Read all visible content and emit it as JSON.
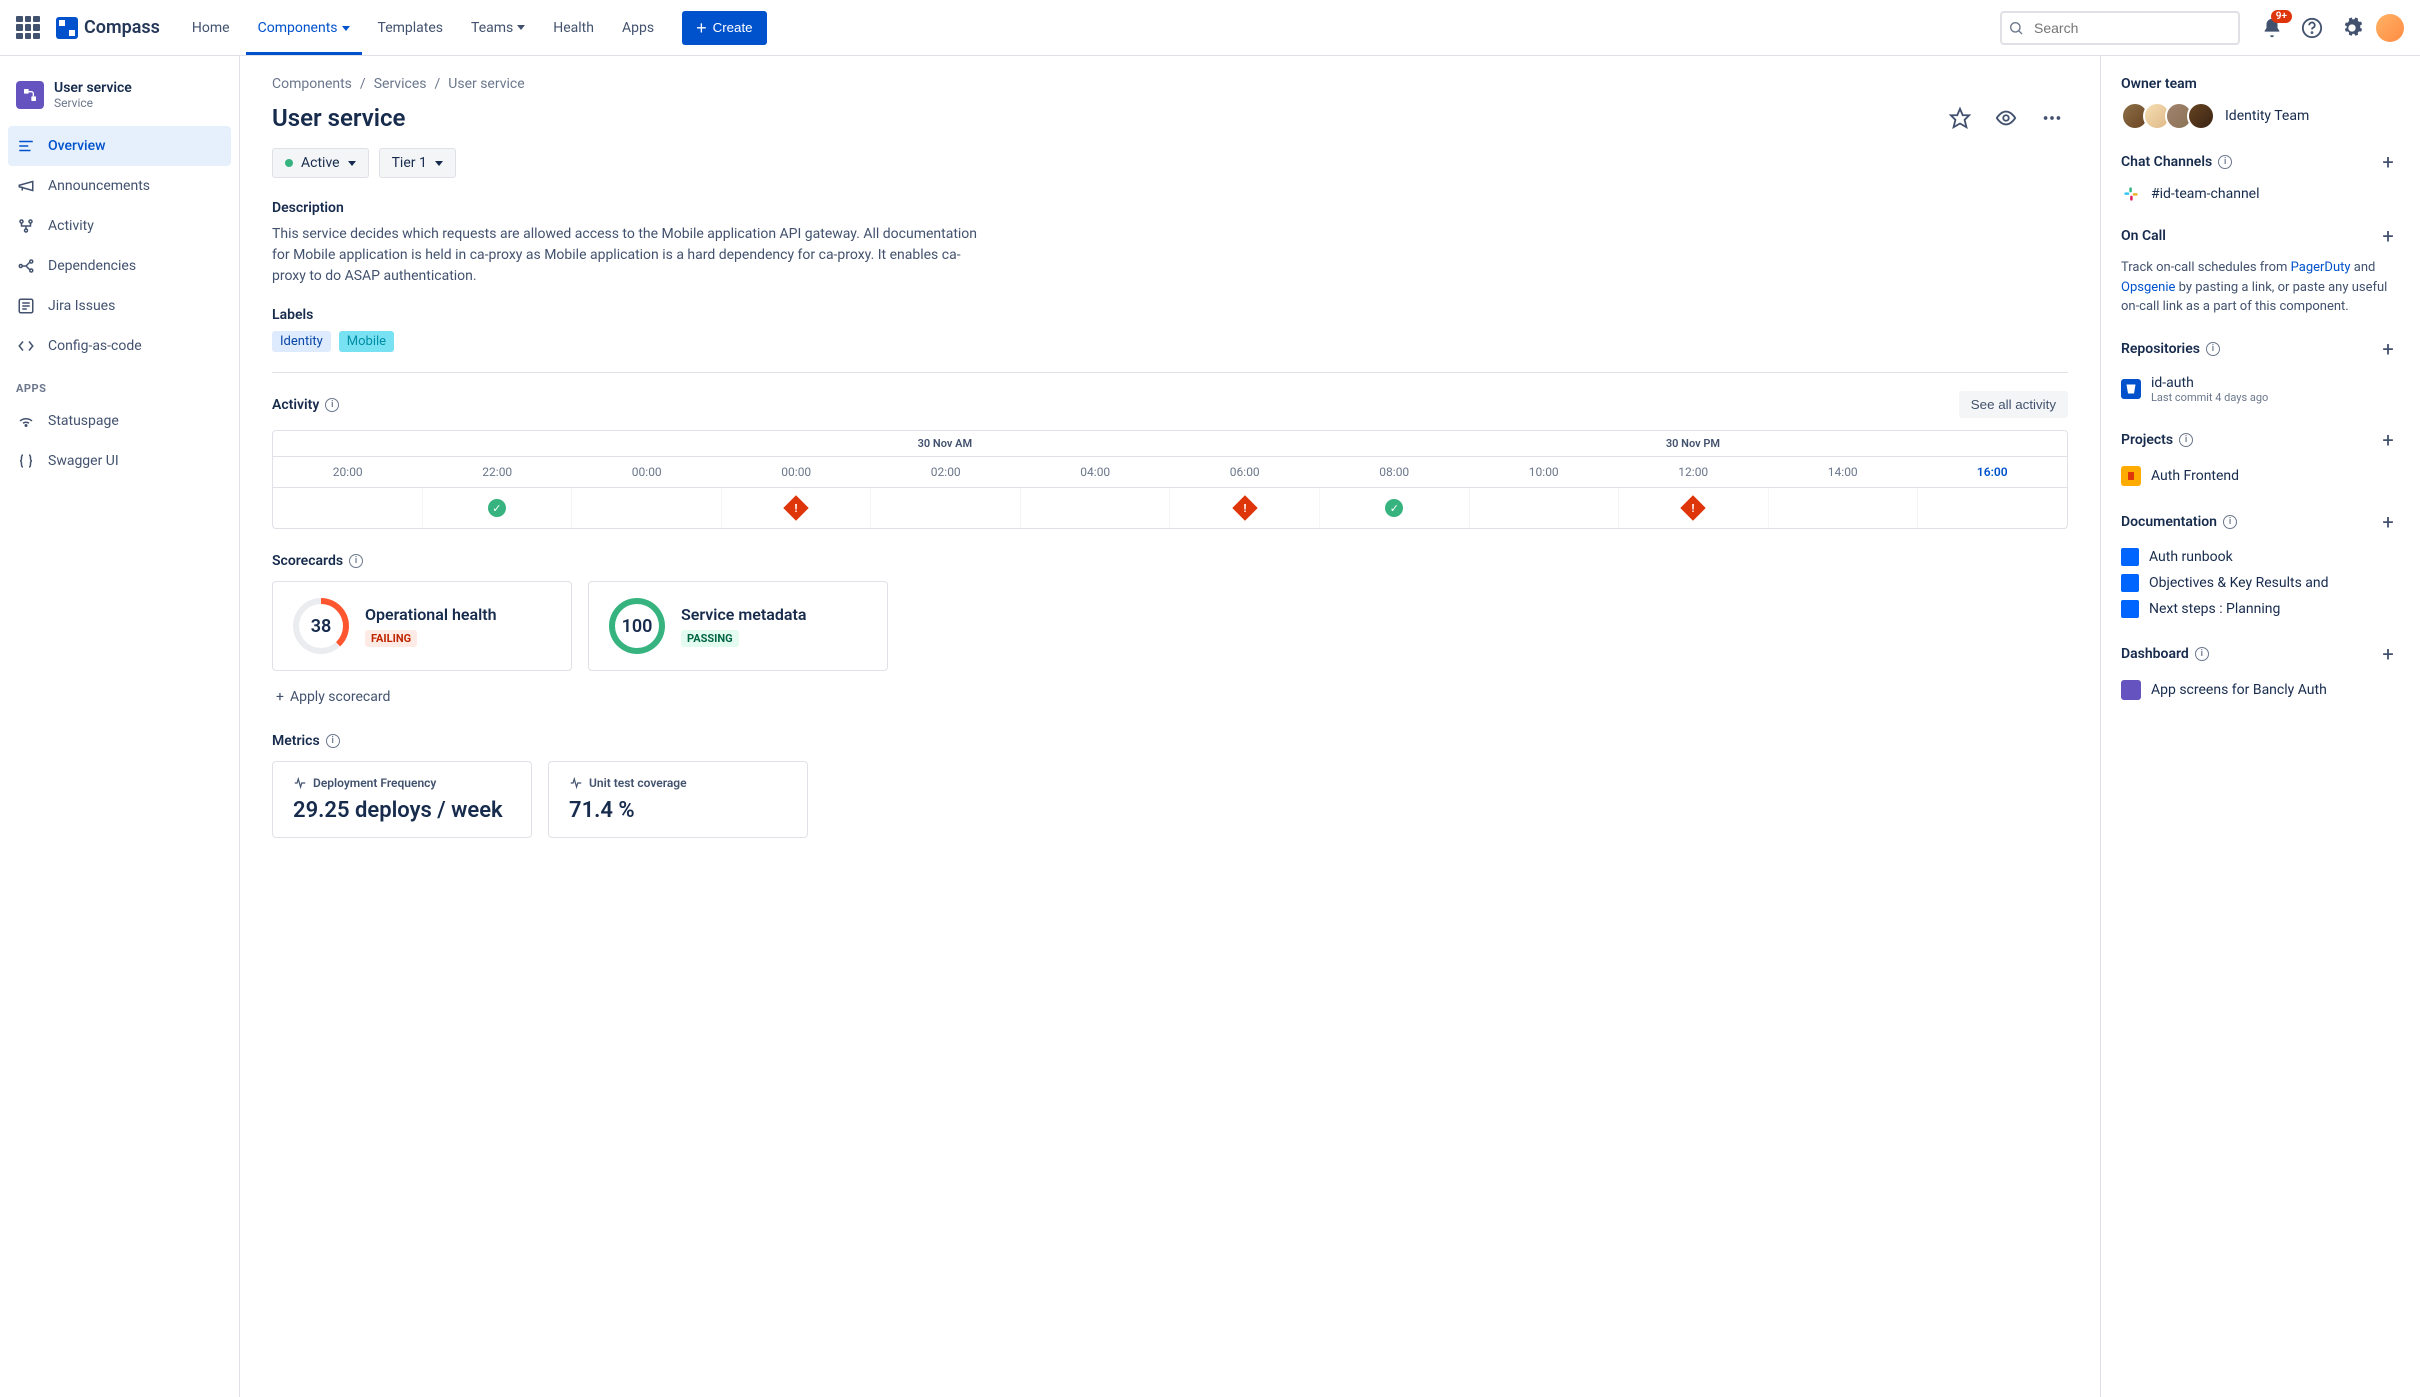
{
  "brand": "Compass",
  "nav": {
    "home": "Home",
    "components": "Components",
    "templates": "Templates",
    "teams": "Teams",
    "health": "Health",
    "apps": "Apps"
  },
  "create": "Create",
  "search_placeholder": "Search",
  "notif_badge": "9+",
  "sidebar": {
    "title": "User service",
    "subtitle": "Service",
    "items": {
      "overview": "Overview",
      "announcements": "Announcements",
      "activity": "Activity",
      "dependencies": "Dependencies",
      "jira": "Jira Issues",
      "cac": "Config-as-code"
    },
    "apps_header": "APPS",
    "apps": {
      "statuspage": "Statuspage",
      "swagger": "Swagger UI"
    }
  },
  "breadcrumb": {
    "a": "Components",
    "b": "Services",
    "c": "User service"
  },
  "page_title": "User service",
  "status_pill": "Active",
  "tier_pill": "Tier 1",
  "desc_h": "Description",
  "desc_body": "This service decides which requests are allowed access to the Mobile application API gateway. All documentation for Mobile application is held in ca-proxy as Mobile application is a hard dependency for ca-proxy. It enables ca-proxy to do ASAP authentication.",
  "labels_h": "Labels",
  "labels": {
    "identity": "Identity",
    "mobile": "Mobile"
  },
  "activity_h": "Activity",
  "see_all": "See all activity",
  "timeline": {
    "day_a": "30 Nov AM",
    "day_b": "30 Nov PM",
    "times": [
      "20:00",
      "22:00",
      "00:00",
      "00:00",
      "02:00",
      "04:00",
      "06:00",
      "08:00",
      "10:00",
      "12:00",
      "14:00",
      "16:00"
    ]
  },
  "scorecards_h": "Scorecards",
  "sc1": {
    "score": "38",
    "title": "Operational health",
    "status": "FAILING"
  },
  "sc2": {
    "score": "100",
    "title": "Service metadata",
    "status": "PASSING"
  },
  "apply_sc": "Apply scorecard",
  "metrics_h": "Metrics",
  "m1": {
    "label": "Deployment Frequency",
    "value": "29.25 deploys / week"
  },
  "m2": {
    "label": "Unit test coverage",
    "value": "71.4 %"
  },
  "rp": {
    "owner_h": "Owner team",
    "team_name": "Identity Team",
    "chat_h": "Chat Channels",
    "chat_name": "#id-team-channel",
    "oncall_h": "On Call",
    "oncall_text_a": "Track on-call schedules from ",
    "oncall_link_a": "PagerDuty",
    "oncall_text_b": " and ",
    "oncall_link_b": "Opsgenie",
    "oncall_text_c": " by pasting a link, or paste any useful on-call link as a part of this component.",
    "repos_h": "Repositories",
    "repo_name": "id-auth",
    "repo_meta": "Last commit 4 days ago",
    "projects_h": "Projects",
    "proj_name": "Auth Frontend",
    "docs_h": "Documentation",
    "doc1": "Auth runbook",
    "doc2": "Objectives & Key Results and",
    "doc3": "Next steps : Planning",
    "dash_h": "Dashboard",
    "dash1": "App screens for Bancly Auth"
  }
}
